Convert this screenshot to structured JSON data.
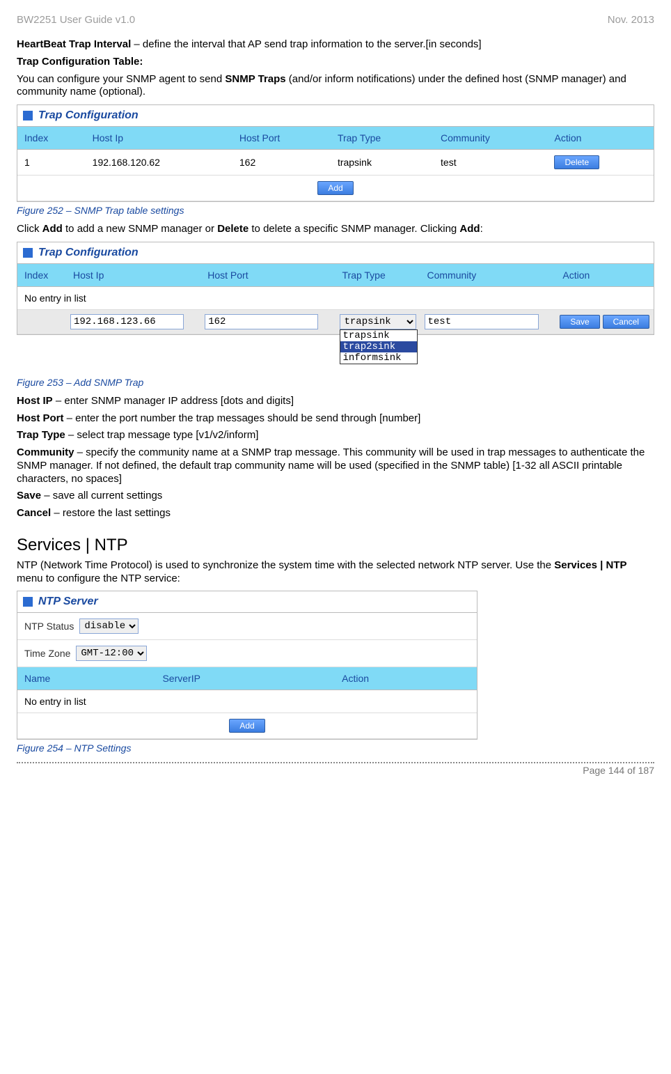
{
  "header": {
    "left": "BW2251 User Guide v1.0",
    "right": "Nov.  2013"
  },
  "para1": {
    "label": "HeartBeat Trap Interval",
    "rest": " – define the interval that AP send trap information to the server.[in seconds]"
  },
  "trap_conf_heading": "Trap Configuration Table:",
  "trap_conf_intro_a": "You can configure your SNMP agent to send ",
  "trap_conf_intro_b": "SNMP Traps",
  "trap_conf_intro_c": " (and/or inform notifications) under the defined host (SNMP manager) and community name (optional).",
  "panel1": {
    "title": "Trap Configuration",
    "cols": [
      "Index",
      "Host Ip",
      "Host Port",
      "Trap Type",
      "Community",
      "Action"
    ],
    "row": {
      "index": "1",
      "hostip": "192.168.120.62",
      "hostport": "162",
      "traptype": "trapsink",
      "community": "test"
    },
    "delete_btn": "Delete",
    "add_btn": "Add"
  },
  "fig252": "Figure 252 – SNMP Trap table settings",
  "click_add_a": "Click ",
  "click_add_b": "Add",
  "click_add_c": " to add a new SNMP manager or ",
  "click_add_d": "Delete",
  "click_add_e": " to delete a specific SNMP manager. Clicking ",
  "click_add_f": "Add",
  "click_add_g": ":",
  "panel2": {
    "title": "Trap Configuration",
    "cols": [
      "Index",
      "Host Ip",
      "Host Port",
      "Trap Type",
      "Community",
      "Action"
    ],
    "noentry": "No entry in list",
    "input": {
      "hostip": "192.168.123.66",
      "hostport": "162",
      "traptype": "trapsink",
      "community": "test"
    },
    "options": [
      "trapsink",
      "trap2sink",
      "informsink"
    ],
    "save_btn": "Save",
    "cancel_btn": "Cancel"
  },
  "fig253": "Figure 253 – Add SNMP Trap",
  "defs": {
    "hostip_l": "Host IP",
    "hostip_t": " – enter SNMP manager IP address [dots and digits]",
    "hostport_l": "Host Port",
    "hostport_t": " – enter the port number the trap messages should be send through [number]",
    "traptype_l": "Trap Type",
    "traptype_t": " – select trap message type [v1/v2/inform]",
    "community_l": "Community",
    "community_t": " – specify the community name at a SNMP trap message. This community will be used in trap messages to authenticate the SNMP manager. If not defined, the default trap community name will be used (specified in the SNMP table) [1-32 all ASCII printable characters, no spaces]",
    "save_l": "Save",
    "save_t": " – save all current settings",
    "cancel_l": "Cancel",
    "cancel_t": " – restore the last settings"
  },
  "ntp_heading": "Services | NTP",
  "ntp_intro_a": "NTP (Network Time Protocol) is used to synchronize the system time with the selected network NTP server. Use the ",
  "ntp_intro_b": "Services | NTP",
  "ntp_intro_c": " menu to configure the NTP service:",
  "panel3": {
    "title": "NTP Server",
    "status_label": "NTP Status",
    "status_value": "disable",
    "tz_label": "Time Zone",
    "tz_value": "GMT-12:00",
    "cols": [
      "Name",
      "ServerIP",
      "Action"
    ],
    "noentry": "No entry in list",
    "add_btn": "Add"
  },
  "fig254": "Figure 254 – NTP Settings",
  "footer": "Page 144 of 187"
}
